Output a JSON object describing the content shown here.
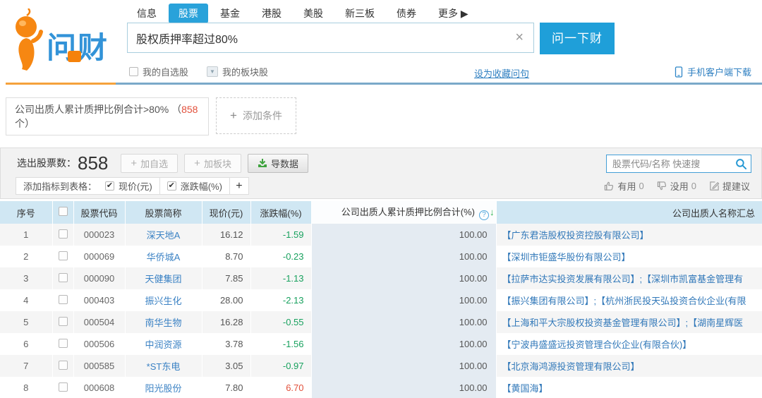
{
  "brand": {
    "name": "问财"
  },
  "nav": {
    "items": [
      {
        "label": "信息",
        "active": false
      },
      {
        "label": "股票",
        "active": true
      },
      {
        "label": "基金",
        "active": false
      },
      {
        "label": "港股",
        "active": false
      },
      {
        "label": "美股",
        "active": false
      },
      {
        "label": "新三板",
        "active": false
      },
      {
        "label": "债券",
        "active": false
      },
      {
        "label": "更多 ▶",
        "active": false
      }
    ]
  },
  "search": {
    "query": "股权质押率超过80%",
    "clear_icon": "×",
    "ask_button": "问一下财",
    "my_watchlist": "我的自选股",
    "my_sector": "我的板块股",
    "sector_dropdown_icon": "▼",
    "favorite_link": "设为收藏问句",
    "mobile_download": "手机客户端下载"
  },
  "condition": {
    "prefix": "公司出质人累计质押比例合计>80% （",
    "count": "858",
    "suffix": "个）",
    "add_plus": "+",
    "add_label": "添加条件"
  },
  "toolbar": {
    "selected_label": "选出股票数：",
    "selected_count": "858",
    "add_watch_plus": "+",
    "add_watch": "加自选",
    "add_sector_plus": "+",
    "add_sector": "加板块",
    "export_label": "导数据",
    "indicator_label": "添加指标到表格：",
    "indicators": [
      "现价(元)",
      "涨跌幅(%)"
    ],
    "indicator_add": "+",
    "quick_search_placeholder": "股票代码/名称 快速搜",
    "useful_label": "有用",
    "useful_count": "0",
    "useless_label": "没用",
    "useless_count": "0",
    "suggest_label": "提建议"
  },
  "table": {
    "headers": {
      "seq": "序号",
      "code": "股票代码",
      "name": "股票简称",
      "price": "现价(元)",
      "change": "涨跌幅(%)",
      "ratio": "公司出质人累计质押比例合计(%)",
      "companies": "公司出质人名称汇总"
    },
    "help_icon": "?",
    "sort_icon": "↓",
    "rows": [
      {
        "seq": "1",
        "code": "000023",
        "name": "深天地A",
        "price": "16.12",
        "change": "-1.59",
        "ratio": "100.00",
        "companies": "【广东君浩股权投资控股有限公司】"
      },
      {
        "seq": "2",
        "code": "000069",
        "name": "华侨城A",
        "price": "8.70",
        "change": "-0.23",
        "ratio": "100.00",
        "companies": "【深圳市钜盛华股份有限公司】"
      },
      {
        "seq": "3",
        "code": "000090",
        "name": "天健集团",
        "price": "7.85",
        "change": "-1.13",
        "ratio": "100.00",
        "companies": "【拉萨市达实投资发展有限公司】;【深圳市凯富基金管理有"
      },
      {
        "seq": "4",
        "code": "000403",
        "name": "振兴生化",
        "price": "28.00",
        "change": "-2.13",
        "ratio": "100.00",
        "companies": "【振兴集团有限公司】;【杭州浙民投天弘投资合伙企业(有限"
      },
      {
        "seq": "5",
        "code": "000504",
        "name": "南华生物",
        "price": "16.28",
        "change": "-0.55",
        "ratio": "100.00",
        "companies": "【上海和平大宗股权投资基金管理有限公司】;【湖南星辉医"
      },
      {
        "seq": "6",
        "code": "000506",
        "name": "中润资源",
        "price": "3.78",
        "change": "-1.56",
        "ratio": "100.00",
        "companies": "【宁波冉盛盛远投资管理合伙企业(有限合伙)】"
      },
      {
        "seq": "7",
        "code": "000585",
        "name": "*ST东电",
        "price": "3.05",
        "change": "-0.97",
        "ratio": "100.00",
        "companies": "【北京海鸿源投资管理有限公司】"
      },
      {
        "seq": "8",
        "code": "000608",
        "name": "阳光股份",
        "price": "7.80",
        "change": "6.70",
        "ratio": "100.00",
        "companies": "【黄国海】"
      }
    ]
  },
  "colors": {
    "accent_blue": "#29a2da",
    "brand_orange": "#f5820b",
    "link_blue": "#3178b9",
    "up_red": "#e2503b",
    "down_green": "#18a15e",
    "header_bg": "#d0e7f3",
    "sorted_col_bg": "#e4ebf2"
  }
}
